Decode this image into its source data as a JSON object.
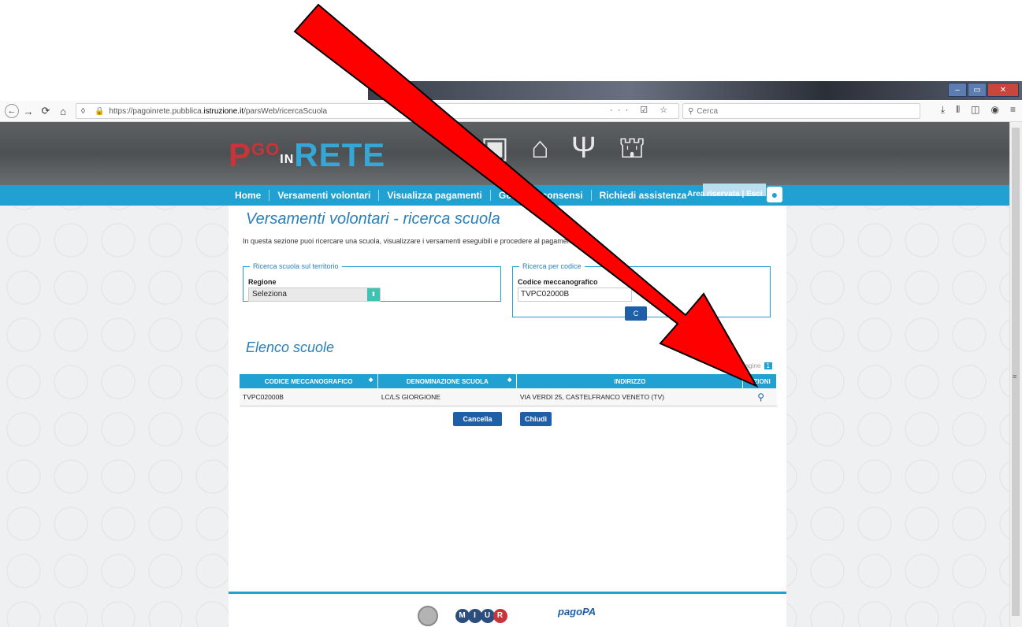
{
  "browser": {
    "url": "https://pagoinrete.pubblica.istruzione.it/parsWeb/ricercaScuola",
    "url_prefix": "https://pagoinrete.pubblica.",
    "url_domain": "istruzione.it",
    "url_suffix": "/parsWeb/ricercaScuola",
    "url_actions": "··· ☑ ☆",
    "search_placeholder": "Cerca"
  },
  "site": {
    "logo_p": "P",
    "logo_go": "GO",
    "logo_in": "IN",
    "logo_rete": "RETE",
    "menu": [
      "Home",
      "Versamenti volontari",
      "Visualizza pagamenti",
      "Gestione consensi",
      "Richiedi assistenza"
    ],
    "reserved_area": "Area riservata | Esci"
  },
  "page": {
    "title": "Versamenti volontari - ricerca scuola",
    "intro": "In questa sezione puoi ricercare una scuola, visualizzare i versamenti eseguibili e procedere al pagamento.",
    "territory": {
      "legend": "Ricerca scuola sul territorio",
      "region_label": "Regione",
      "region_value": "Seleziona"
    },
    "code": {
      "legend": "Ricerca per codice",
      "code_label": "Codice meccanografico",
      "code_value": "TVPC02000B",
      "search_button": "C"
    },
    "list_title": "Elenco scuole",
    "pager_label": "Pagine",
    "pager_num": "1",
    "table": {
      "headers": [
        "CODICE MECCANOGRAFICO",
        "DENOMINAZIONE SCUOLA",
        "INDIRIZZO",
        "AZIONI"
      ],
      "rows": [
        [
          "TVPC02000B",
          "LC/LS GIORGIONE",
          "VIA VERDI 25, CASTELFRANCO VENETO (TV)"
        ]
      ]
    },
    "buttons": {
      "cancel": "Cancella",
      "close": "Chiudi"
    },
    "footer": {
      "miur": "MIUR",
      "pagopa": "pagoPA"
    }
  },
  "colors": {
    "accent": "#21a1d2",
    "button": "#1f5fa8",
    "arrow": "#ff0000"
  }
}
